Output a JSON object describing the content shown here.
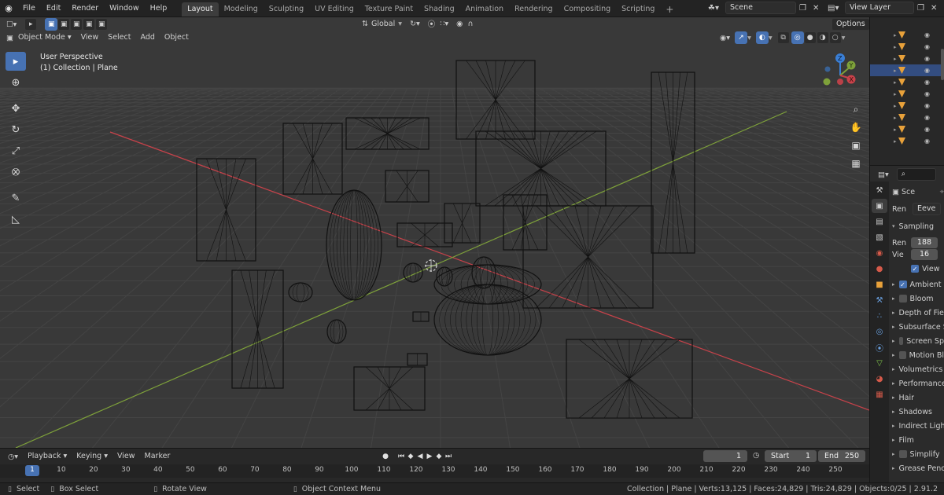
{
  "topbar": {
    "menu": [
      "File",
      "Edit",
      "Render",
      "Window",
      "Help"
    ],
    "workspace_tabs": [
      "Layout",
      "Modeling",
      "Sculpting",
      "UV Editing",
      "Texture Paint",
      "Shading",
      "Animation",
      "Rendering",
      "Compositing",
      "Scripting"
    ],
    "active_tab": "Layout",
    "add_tab": "+",
    "scene": "Scene",
    "view_layer": "View Layer"
  },
  "viewport_header": {
    "mode": "Object Mode",
    "menus": [
      "View",
      "Select",
      "Add",
      "Object"
    ],
    "transform_orientation": "Global",
    "options": "Options"
  },
  "viewport": {
    "perspective": "User Perspective",
    "collection": "(1) Collection | Plane",
    "gizmo_axes": [
      "Z",
      "Y",
      "X"
    ],
    "colors": {
      "x_axis": "#c9424a",
      "y_axis": "#7ea13a",
      "z_axis": "#3a7fd6",
      "background": "#393939",
      "wire": "#111111"
    }
  },
  "tools": [
    "select-box",
    "cursor",
    "move",
    "rotate",
    "scale",
    "transform",
    "annotate",
    "measure"
  ],
  "outliner": {
    "row_count": 10,
    "selected_row": 3
  },
  "properties": {
    "object_name": "Sce",
    "render_engine_label": "Ren",
    "render_engine": "Eeve",
    "sampling": {
      "header": "Sampling",
      "render_label": "Ren",
      "render_value": "188",
      "viewport_label": "Vie",
      "viewport_value": "16",
      "denoise": "View"
    },
    "panels": [
      {
        "label": "Ambient",
        "checkbox": true,
        "checked": true
      },
      {
        "label": "Bloom",
        "checkbox": true,
        "checked": false
      },
      {
        "label": "Depth of Fiel",
        "checkbox": false
      },
      {
        "label": "Subsurface S",
        "checkbox": false
      },
      {
        "label": "Screen Sp",
        "checkbox": true,
        "checked": false
      },
      {
        "label": "Motion Bl",
        "checkbox": true,
        "checked": false
      },
      {
        "label": "Volumetrics",
        "checkbox": false
      },
      {
        "label": "Performance",
        "checkbox": false
      },
      {
        "label": "Hair",
        "checkbox": false
      },
      {
        "label": "Shadows",
        "checkbox": false
      },
      {
        "label": "Indirect Light",
        "checkbox": false
      },
      {
        "label": "Film",
        "checkbox": false
      },
      {
        "label": "Simplify",
        "checkbox": true,
        "checked": false
      },
      {
        "label": "Grease Penc",
        "checkbox": false
      }
    ]
  },
  "timeline": {
    "menus": [
      "Playback",
      "Keying",
      "View",
      "Marker"
    ],
    "current_frame": "1",
    "start_label": "Start",
    "start": "1",
    "end_label": "End",
    "end": "250",
    "ruler": [
      "1",
      "10",
      "20",
      "30",
      "40",
      "50",
      "60",
      "70",
      "80",
      "90",
      "100",
      "110",
      "120",
      "130",
      "140",
      "150",
      "160",
      "170",
      "180",
      "190",
      "200",
      "210",
      "220",
      "230",
      "240",
      "250"
    ]
  },
  "statusbar": {
    "select": "Select",
    "box_select": "Box Select",
    "rotate_view": "Rotate View",
    "context_menu": "Object Context Menu",
    "stats": "Collection | Plane | Verts:13,125 | Faces:24,829 | Tris:24,829 | Objects:0/25 | 2.91.2"
  }
}
